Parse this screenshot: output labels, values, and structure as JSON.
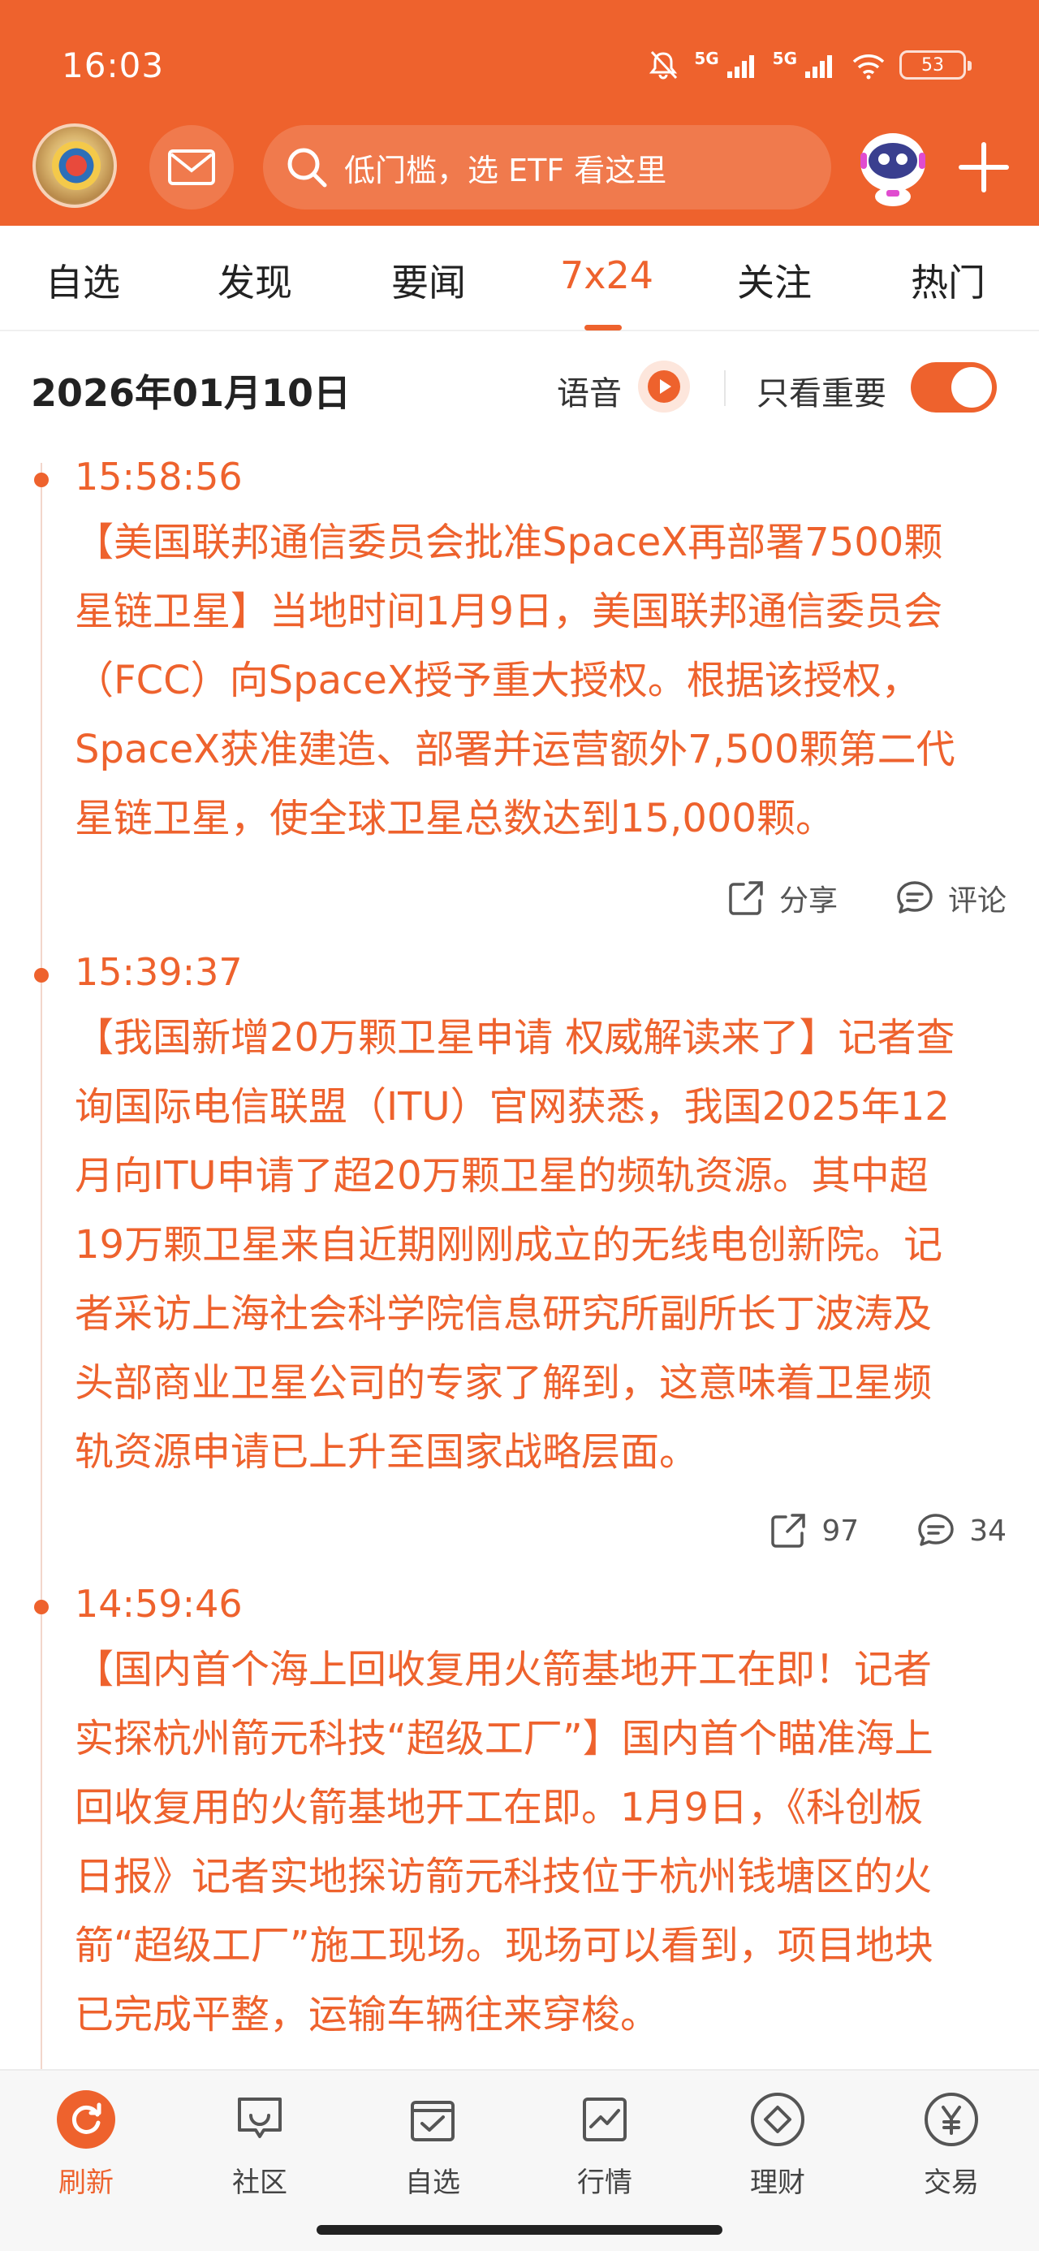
{
  "status_bar": {
    "time": "16:03",
    "signal_1": "5G",
    "signal_2": "5G",
    "battery": "53"
  },
  "header": {
    "search_placeholder": "低门槛，选 ETF 看这里"
  },
  "tabs": [
    {
      "label": "自选",
      "active": false
    },
    {
      "label": "发现",
      "active": false
    },
    {
      "label": "要闻",
      "active": false
    },
    {
      "label": "7x24",
      "active": true
    },
    {
      "label": "关注",
      "active": false
    },
    {
      "label": "热门",
      "active": false
    }
  ],
  "filter": {
    "date": "2026年01月10日",
    "voice_label": "语音",
    "important_only_label": "只看重要",
    "important_only_on": true
  },
  "news": [
    {
      "time": "15:58:56",
      "lines": [
        "【美国联邦通信委员会批准SpaceX再部署7500颗",
        "星链卫星】当地时间1月9日，美国联邦通信委员会",
        "（FCC）向SpaceX授予重大授权。根据该授权，",
        "SpaceX获准建造、部署并运营额外7,500颗第二代",
        "星链卫星，使全球卫星总数达到15,000颗。"
      ],
      "share_label": "分享",
      "comment_label": "评论"
    },
    {
      "time": "15:39:37",
      "lines": [
        "【我国新增20万颗卫星申请 权威解读来了】记者查",
        "询国际电信联盟（ITU）官网获悉，我国2025年12",
        "月向ITU申请了超20万颗卫星的频轨资源。其中超",
        "19万颗卫星来自近期刚刚成立的无线电创新院。记",
        "者采访上海社会科学院信息研究所副所长丁波涛及",
        "头部商业卫星公司的专家了解到，这意味着卫星频",
        "轨资源申请已上升至国家战略层面。"
      ],
      "share_label": "97",
      "comment_label": "34"
    },
    {
      "time": "14:59:46",
      "lines": [
        "【国内首个海上回收复用火箭基地开工在即！记者",
        "实探杭州箭元科技“超级工厂”】国内首个瞄准海上",
        "回收复用的火箭基地开工在即。1月9日，《科创板",
        "日报》记者实地探访箭元科技位于杭州钱塘区的火",
        "箭“超级工厂”施工现场。现场可以看到，项目地块",
        "已完成平整，运输车辆往来穿梭。"
      ]
    }
  ],
  "bottom_nav": [
    {
      "label": "刷新",
      "icon": "refresh-icon",
      "active": true
    },
    {
      "label": "社区",
      "icon": "community-icon",
      "active": false
    },
    {
      "label": "自选",
      "icon": "watchlist-icon",
      "active": false
    },
    {
      "label": "行情",
      "icon": "market-icon",
      "active": false
    },
    {
      "label": "理财",
      "icon": "wealth-icon",
      "active": false
    },
    {
      "label": "交易",
      "icon": "trade-icon",
      "active": false
    }
  ],
  "colors": {
    "accent": "#ee622d",
    "news_text": "#ee622d"
  }
}
